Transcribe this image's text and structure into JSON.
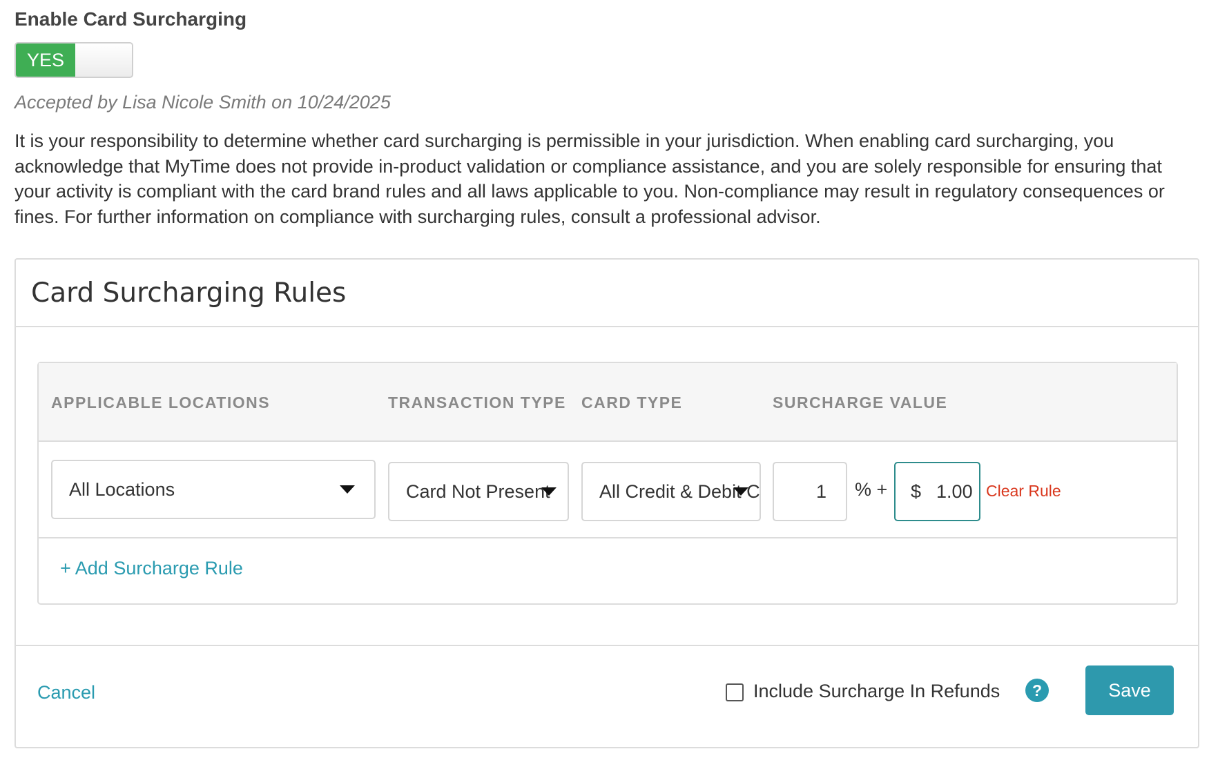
{
  "surcharging": {
    "title": "Enable Card Surcharging",
    "toggle_label": "YES",
    "accepted_text": "Accepted by Lisa Nicole Smith on 10/24/2025",
    "disclaimer": "It is your responsibility to determine whether card surcharging is permissible in your jurisdiction. When enabling card surcharging, you acknowledge that MyTime does not provide in-product validation or compliance assistance, and you are solely responsible for ensuring that your activity is compliant with the card brand rules and all laws applicable to you. Non-compliance may result in regulatory consequences or fines. For further information on compliance with surcharging rules, consult a professional advisor."
  },
  "rules_panel": {
    "title": "Card Surcharging Rules",
    "columns": [
      "APPLICABLE LOCATIONS",
      "TRANSACTION TYPE",
      "CARD TYPE",
      "SURCHARGE VALUE"
    ],
    "rows": [
      {
        "location": "All Locations",
        "transaction_type": "Card Not Present",
        "card_type": "All Credit & Debit C",
        "percent_value": "1",
        "percent_sep": "% +",
        "currency": "$",
        "fixed_value": "1.00",
        "clear_label": "Clear Rule"
      }
    ],
    "add_rule_label": "+ Add Surcharge Rule"
  },
  "footer": {
    "cancel_label": "Cancel",
    "refund_label": "Include Surcharge In Refunds",
    "help_glyph": "?",
    "save_label": "Save"
  },
  "colors": {
    "toggle_on": "#3fae54",
    "link": "#2a9bb0",
    "danger": "#d9381e",
    "save": "#2e99ad"
  }
}
